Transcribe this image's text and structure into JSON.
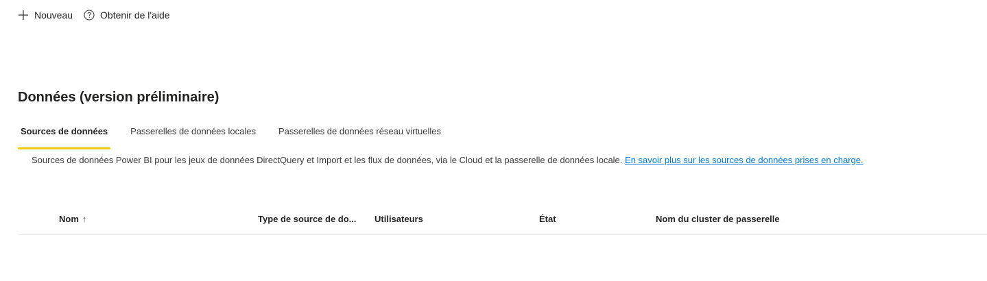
{
  "toolbar": {
    "new_label": "Nouveau",
    "help_label": "Obtenir de l'aide",
    "new_icon": "plus-icon",
    "help_icon": "help-circle-icon"
  },
  "page": {
    "title": "Données (version préliminaire)"
  },
  "tabs": [
    {
      "label": "Sources de données",
      "active": true
    },
    {
      "label": "Passerelles de données locales",
      "active": false
    },
    {
      "label": "Passerelles de données réseau virtuelles",
      "active": false
    }
  ],
  "description": {
    "text": "Sources de données Power BI pour les jeux de données DirectQuery et Import et les flux de données, via le Cloud et la passerelle de données locale.",
    "link": "En savoir plus sur les sources de données prises en charge."
  },
  "table": {
    "columns": [
      {
        "label": "Nom",
        "sort": "ascending"
      },
      {
        "label": "Type de source de do..."
      },
      {
        "label": "Utilisateurs"
      },
      {
        "label": "État"
      },
      {
        "label": "Nom du cluster de passerelle"
      }
    ],
    "sort_indicator": "↑"
  },
  "colors": {
    "accent": "#f2c811",
    "link": "#0078d4"
  }
}
